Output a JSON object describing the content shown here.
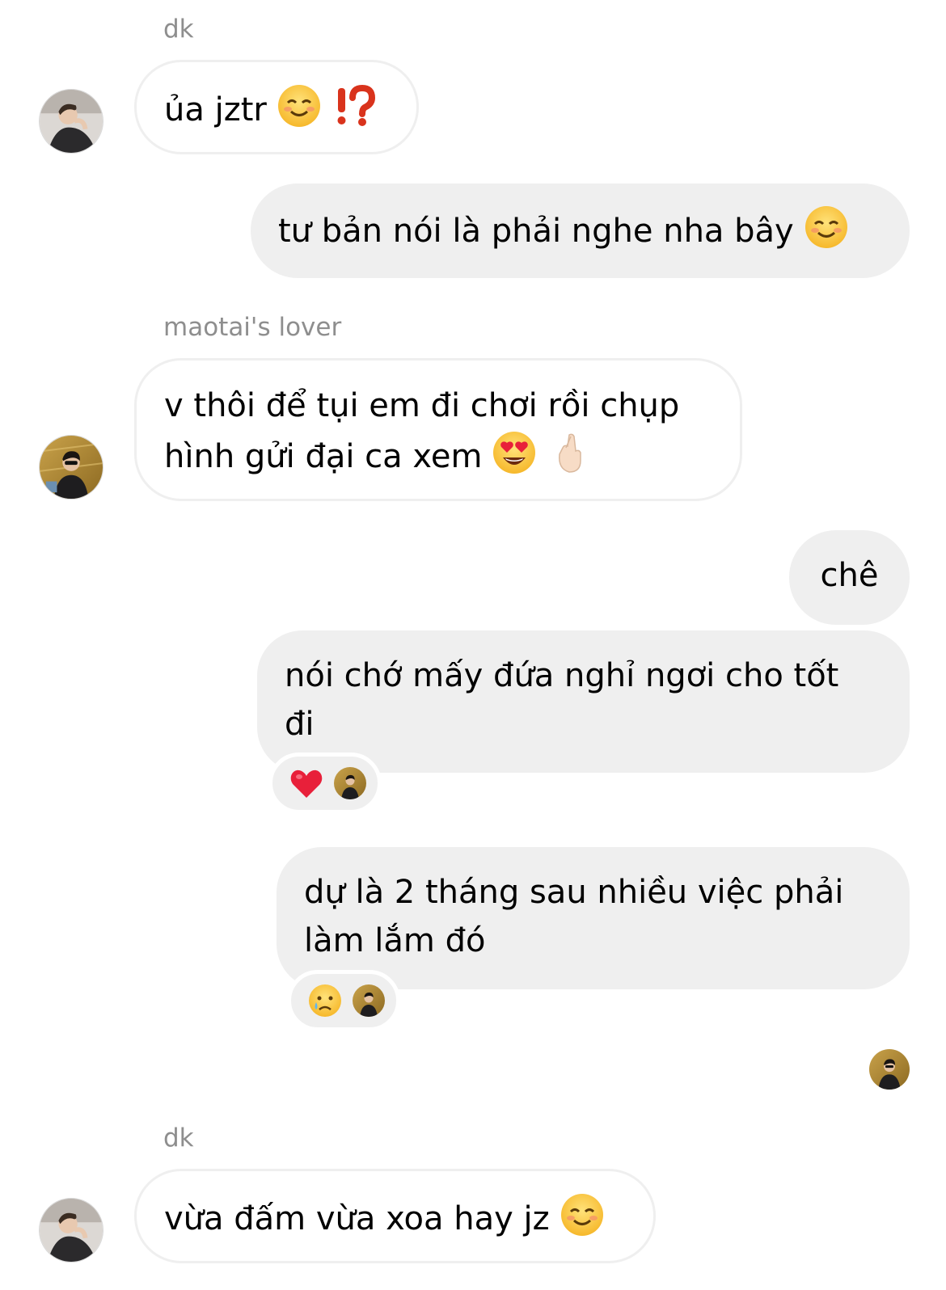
{
  "messages": {
    "m1": {
      "sender": "dk",
      "text": "ủa jztr",
      "emojis": [
        "smiling-face-icon",
        "exclamation-question-icon"
      ]
    },
    "m2": {
      "text": "tư bản nói là phải nghe nha bây",
      "emojis": [
        "smiling-face-icon"
      ]
    },
    "m3": {
      "sender": "maotai's lover",
      "line1": "v thôi để tụi em đi chơi rồi chụp",
      "line2": "hình gửi đại ca xem",
      "emojis": [
        "heart-eyes-icon",
        "crossed-fingers-icon"
      ]
    },
    "m4": {
      "text": "chê"
    },
    "m5": {
      "line1": "nói chớ mấy đứa nghỉ ngơi cho tốt",
      "line2": "đi",
      "reaction": "red-heart-icon"
    },
    "m6": {
      "line1": "dự là 2 tháng sau nhiều việc phải",
      "line2": "làm lắm đó",
      "reaction": "sad-tear-face-icon"
    },
    "m7": {
      "sender": "dk",
      "text": "vừa đấm vừa xoa hay jz",
      "emojis": [
        "smiling-face-icon"
      ]
    }
  },
  "colors": {
    "outgoing_bubble": "#efefef",
    "incoming_border": "#efefef",
    "sender_name": "#8e8e8e"
  }
}
